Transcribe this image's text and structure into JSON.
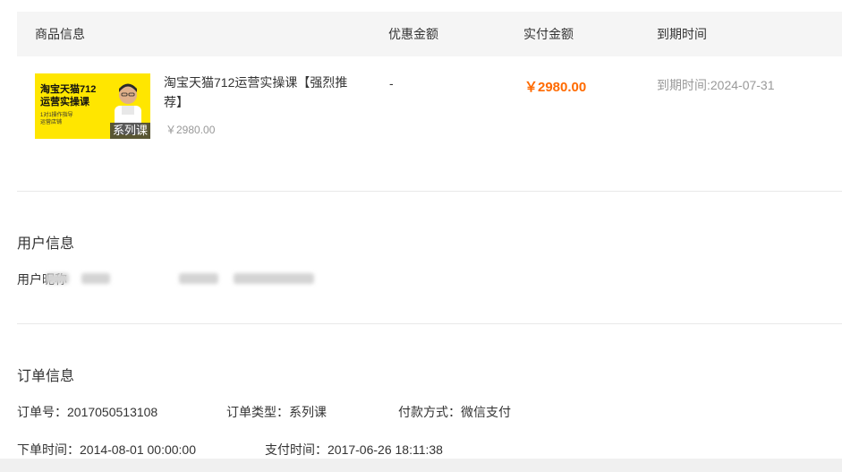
{
  "table_header": {
    "product_info": "商品信息",
    "discount_amount": "优惠金额",
    "paid_amount": "实付金额",
    "expire_time": "到期时间"
  },
  "product": {
    "cover_title": "淘宝天猫712\n运营实操课",
    "cover_sub": "1对1操作指导\n运营店铺",
    "cover_badge": "系列课",
    "title": "淘宝天猫712运营实操课【强烈推荐】",
    "price": "￥2980.00",
    "discount": "-",
    "paid": "￥2980.00",
    "expire": "到期时间:2024-07-31"
  },
  "user_section": {
    "title": "用户信息",
    "nickname_label": "用户昵称"
  },
  "order_section": {
    "title": "订单信息",
    "order_no": "订单号：2017050513108",
    "order_type": "订单类型：系列课",
    "pay_method": "付款方式：微信支付",
    "order_time": "下单时间：2014-08-01 00:00:00",
    "pay_time": "支付时间：2017-06-26 18:11:38"
  },
  "colors": {
    "accent_price": "#ff6a00",
    "header_bg": "#f5f5f5",
    "cover_bg": "#ffe600"
  }
}
